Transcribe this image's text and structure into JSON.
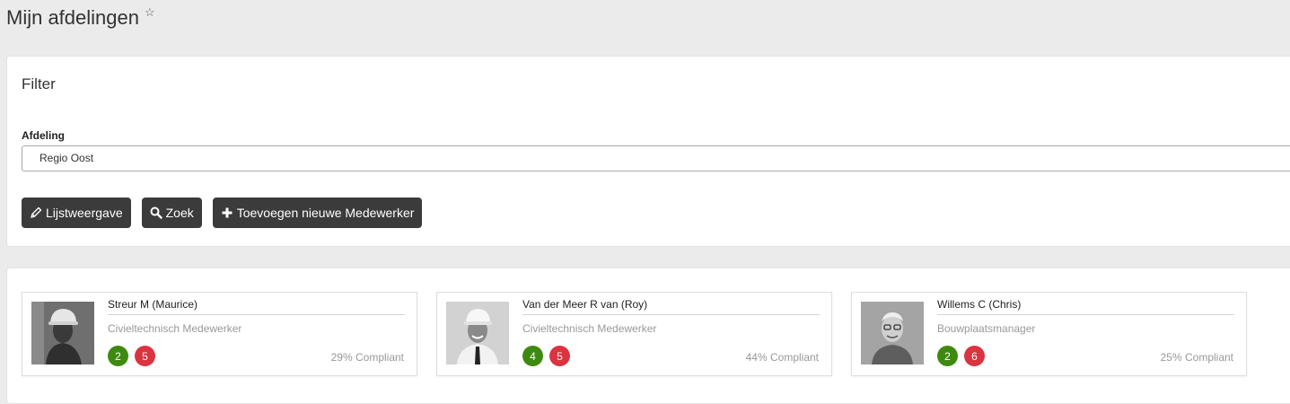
{
  "page": {
    "title": "Mijn afdelingen",
    "star_glyph": "☆"
  },
  "filter": {
    "title": "Filter",
    "field_label": "Afdeling",
    "selected_value": "Regio Oost",
    "buttons": {
      "list_view": "Lijstweergave",
      "search": "Zoek",
      "add_employee": "Toevoegen nieuwe Medewerker"
    }
  },
  "employees": [
    {
      "name": "Streur M (Maurice)",
      "role": "Civieltechnisch Medewerker",
      "green_count": "2",
      "red_count": "5",
      "compliance": "29% Compliant"
    },
    {
      "name": "Van der Meer R van (Roy)",
      "role": "Civieltechnisch Medewerker",
      "green_count": "4",
      "red_count": "5",
      "compliance": "44% Compliant"
    },
    {
      "name": "Willems C (Chris)",
      "role": "Bouwplaatsmanager",
      "green_count": "2",
      "red_count": "6",
      "compliance": "25% Compliant"
    }
  ],
  "colors": {
    "button_bg": "#3b3b3b",
    "badge_green": "#3e8a10",
    "badge_red": "#d9343f",
    "page_bg": "#ebebeb"
  }
}
